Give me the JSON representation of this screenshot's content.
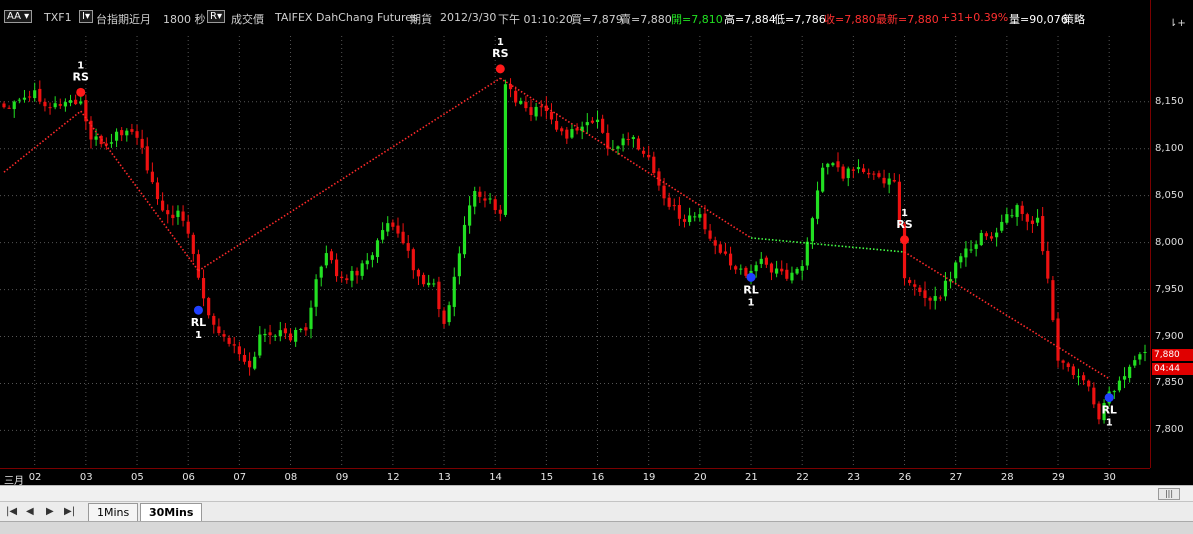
{
  "header": {
    "code_box": "AA",
    "symbol": "TXF1",
    "period_box": "I",
    "contract": "台指期近月",
    "interval": "1800 秒",
    "price_box": "R",
    "price_type": "成交價",
    "exchange": "TAIFEX",
    "broker": "DahChang Futures",
    "market": "期貨",
    "date": "2012/3/30",
    "time": "下午 01:10:20",
    "bid": "買=7,879",
    "ask": "賣=7,880",
    "open": "開=7,810",
    "high": "高=7,884",
    "low": "低=7,786",
    "close": "收=7,880",
    "latest": "最新=7,880",
    "change": "+31",
    "change_pct": "+0.39%",
    "volume": "量=90,076",
    "strategy": "策略"
  },
  "colors": {
    "up": "#22e022",
    "down": "#ee1111",
    "grid": "#555555",
    "trend_red": "#ff2a2a",
    "trend_green": "#44ff44",
    "marker_rs": "#ff1a1a",
    "marker_rl": "#2040ff"
  },
  "last_price_tag": {
    "price": "7,880",
    "change": "04:44"
  },
  "axis_icon": "⇂+",
  "tabs": [
    {
      "label": "1Mins",
      "active": false
    },
    {
      "label": "30Mins",
      "active": true
    }
  ],
  "nav_icons": [
    "first-icon",
    "prev-icon",
    "next-icon",
    "last-icon"
  ],
  "chart_data": {
    "type": "candlestick",
    "ylim": [
      7760,
      8220
    ],
    "yticks": [
      {
        "value": 8150,
        "label": "8,150"
      },
      {
        "value": 8100,
        "label": "8,100"
      },
      {
        "value": 8050,
        "label": "8,050"
      },
      {
        "value": 8000,
        "label": "8,000"
      },
      {
        "value": 7950,
        "label": "7,950"
      },
      {
        "value": 7900,
        "label": "7,900"
      },
      {
        "value": 7850,
        "label": "7,850"
      },
      {
        "value": 7800,
        "label": "7,800"
      }
    ],
    "xticks": [
      {
        "index": 0,
        "label": "三月"
      },
      {
        "index": 6,
        "label": "02"
      },
      {
        "index": 16,
        "label": "03"
      },
      {
        "index": 26,
        "label": "05"
      },
      {
        "index": 36,
        "label": "06"
      },
      {
        "index": 46,
        "label": "07"
      },
      {
        "index": 56,
        "label": "08"
      },
      {
        "index": 66,
        "label": "09"
      },
      {
        "index": 76,
        "label": "12"
      },
      {
        "index": 86,
        "label": "13"
      },
      {
        "index": 96,
        "label": "14"
      },
      {
        "index": 106,
        "label": "15"
      },
      {
        "index": 116,
        "label": "16"
      },
      {
        "index": 126,
        "label": "19"
      },
      {
        "index": 136,
        "label": "20"
      },
      {
        "index": 146,
        "label": "21"
      },
      {
        "index": 156,
        "label": "22"
      },
      {
        "index": 166,
        "label": "23"
      },
      {
        "index": 176,
        "label": "26"
      },
      {
        "index": 186,
        "label": "27"
      },
      {
        "index": 196,
        "label": "28"
      },
      {
        "index": 206,
        "label": "29"
      },
      {
        "index": 216,
        "label": "30"
      }
    ],
    "anchors": [
      [
        0,
        8145
      ],
      [
        3,
        8155
      ],
      [
        6,
        8160
      ],
      [
        9,
        8145
      ],
      [
        12,
        8150
      ],
      [
        15,
        8150
      ],
      [
        17,
        8110
      ],
      [
        20,
        8105
      ],
      [
        22,
        8115
      ],
      [
        25,
        8120
      ],
      [
        27,
        8100
      ],
      [
        29,
        8060
      ],
      [
        31,
        8030
      ],
      [
        34,
        8030
      ],
      [
        36,
        8010
      ],
      [
        38,
        7965
      ],
      [
        40,
        7925
      ],
      [
        42,
        7905
      ],
      [
        44,
        7895
      ],
      [
        46,
        7880
      ],
      [
        48,
        7865
      ],
      [
        50,
        7900
      ],
      [
        53,
        7905
      ],
      [
        56,
        7900
      ],
      [
        59,
        7910
      ],
      [
        61,
        7960
      ],
      [
        63,
        7985
      ],
      [
        66,
        7960
      ],
      [
        69,
        7970
      ],
      [
        72,
        7990
      ],
      [
        75,
        8020
      ],
      [
        77,
        8005
      ],
      [
        79,
        7990
      ],
      [
        81,
        7960
      ],
      [
        84,
        7955
      ],
      [
        86,
        7910
      ],
      [
        88,
        7960
      ],
      [
        90,
        8020
      ],
      [
        92,
        8055
      ],
      [
        95,
        8045
      ],
      [
        97,
        8030
      ],
      [
        98,
        8170
      ],
      [
        100,
        8150
      ],
      [
        103,
        8140
      ],
      [
        106,
        8145
      ],
      [
        108,
        8120
      ],
      [
        110,
        8115
      ],
      [
        113,
        8125
      ],
      [
        116,
        8130
      ],
      [
        118,
        8100
      ],
      [
        120,
        8105
      ],
      [
        123,
        8110
      ],
      [
        126,
        8090
      ],
      [
        128,
        8060
      ],
      [
        130,
        8040
      ],
      [
        133,
        8025
      ],
      [
        136,
        8030
      ],
      [
        138,
        8000
      ],
      [
        140,
        7990
      ],
      [
        143,
        7975
      ],
      [
        146,
        7965
      ],
      [
        148,
        7985
      ],
      [
        150,
        7970
      ],
      [
        153,
        7965
      ],
      [
        156,
        7975
      ],
      [
        158,
        8030
      ],
      [
        160,
        8075
      ],
      [
        162,
        8085
      ],
      [
        164,
        8070
      ],
      [
        166,
        8080
      ],
      [
        168,
        8075
      ],
      [
        170,
        8070
      ],
      [
        172,
        8065
      ],
      [
        174,
        8070
      ],
      [
        176,
        7960
      ],
      [
        178,
        7950
      ],
      [
        181,
        7940
      ],
      [
        183,
        7945
      ],
      [
        185,
        7965
      ],
      [
        187,
        7990
      ],
      [
        189,
        7995
      ],
      [
        191,
        8010
      ],
      [
        193,
        8005
      ],
      [
        196,
        8030
      ],
      [
        198,
        8035
      ],
      [
        200,
        8020
      ],
      [
        202,
        8025
      ],
      [
        204,
        7960
      ],
      [
        206,
        7875
      ],
      [
        208,
        7865
      ],
      [
        210,
        7855
      ],
      [
        212,
        7845
      ],
      [
        214,
        7815
      ],
      [
        216,
        7840
      ],
      [
        218,
        7850
      ],
      [
        220,
        7870
      ],
      [
        222,
        7880
      ]
    ],
    "trend_lines": [
      {
        "color": "red",
        "points": [
          [
            0,
            8075
          ],
          [
            15,
            8140
          ]
        ]
      },
      {
        "color": "red",
        "points": [
          [
            15,
            8140
          ],
          [
            38,
            7970
          ]
        ]
      },
      {
        "color": "red",
        "points": [
          [
            38,
            7970
          ],
          [
            97,
            8175
          ]
        ]
      },
      {
        "color": "red",
        "points": [
          [
            97,
            8175
          ],
          [
            146,
            8005
          ]
        ]
      },
      {
        "color": "green",
        "points": [
          [
            146,
            8005
          ],
          [
            176,
            7990
          ]
        ]
      },
      {
        "color": "red",
        "points": [
          [
            176,
            7990
          ],
          [
            216,
            7855
          ]
        ]
      }
    ],
    "signals": [
      {
        "type": "RS",
        "count": "1",
        "index": 15,
        "price": 8160
      },
      {
        "type": "RL",
        "count": "1",
        "index": 38,
        "price": 7928
      },
      {
        "type": "RS",
        "count": "1",
        "index": 97,
        "price": 8185
      },
      {
        "type": "RL",
        "count": "1",
        "index": 146,
        "price": 7963
      },
      {
        "type": "RS",
        "count": "1",
        "index": 176,
        "price": 8003
      },
      {
        "type": "RL",
        "count": "1",
        "index": 216,
        "price": 7835
      }
    ]
  }
}
